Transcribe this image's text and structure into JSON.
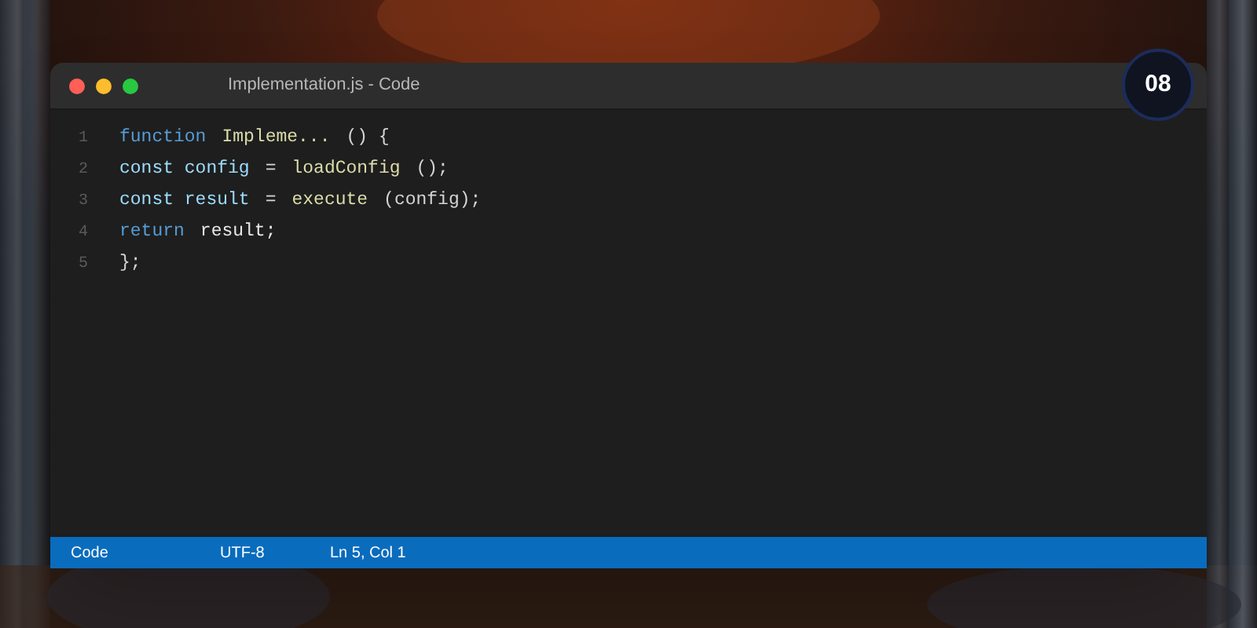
{
  "window": {
    "title": "Implementation.js - Code"
  },
  "badge": "08",
  "code_lines": [
    {
      "number": "1",
      "tokens": [
        {
          "text": "function",
          "kind": "keyword"
        },
        {
          "text": "Impleme...",
          "kind": "function"
        },
        {
          "text": "() {",
          "kind": "punct"
        }
      ]
    },
    {
      "number": "2",
      "tokens": [
        {
          "text": "const config",
          "kind": "variable"
        },
        {
          "text": "=",
          "kind": "punct"
        },
        {
          "text": "loadConfig",
          "kind": "function"
        },
        {
          "text": "();",
          "kind": "punct"
        }
      ]
    },
    {
      "number": "3",
      "tokens": [
        {
          "text": "const result",
          "kind": "variable"
        },
        {
          "text": "=",
          "kind": "punct"
        },
        {
          "text": "execute",
          "kind": "function"
        },
        {
          "text": "(config);",
          "kind": "punct"
        }
      ]
    },
    {
      "number": "4",
      "tokens": [
        {
          "text": "return",
          "kind": "keyword"
        },
        {
          "text": "result;",
          "kind": "plain"
        }
      ]
    },
    {
      "number": "5",
      "tokens": [
        {
          "text": "};",
          "kind": "punct"
        }
      ]
    }
  ],
  "status_bar": [
    "Code",
    "UTF-8",
    "Ln 5, Col 1"
  ]
}
